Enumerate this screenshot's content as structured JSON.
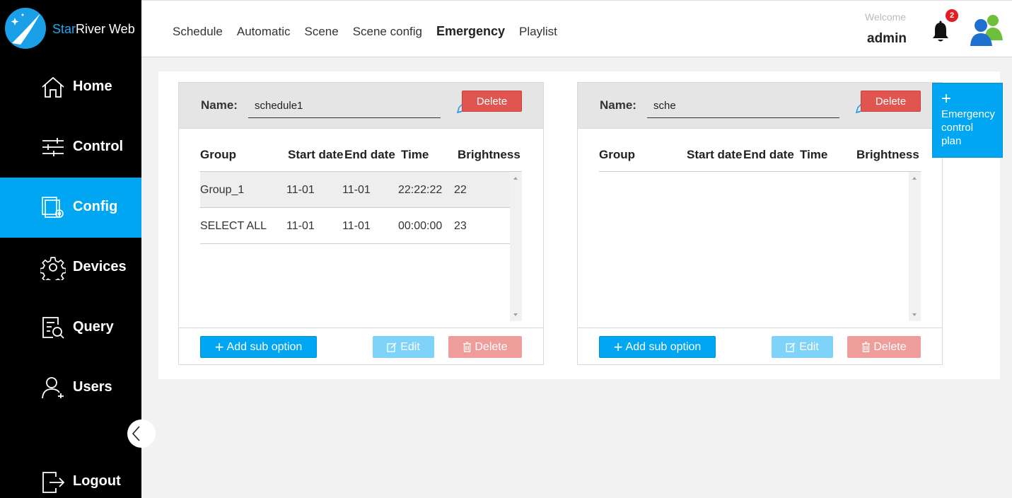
{
  "app": {
    "title_star": "Star",
    "title_rest": "River Web"
  },
  "sidebar": {
    "items": [
      {
        "label": "Home",
        "icon": "home-icon"
      },
      {
        "label": "Control",
        "icon": "sliders-icon"
      },
      {
        "label": "Config",
        "icon": "config-icon",
        "active": true
      },
      {
        "label": "Devices",
        "icon": "gear-icon"
      },
      {
        "label": "Query",
        "icon": "query-icon"
      },
      {
        "label": "Users",
        "icon": "user-icon"
      },
      {
        "label": "Logout",
        "icon": "logout-icon"
      }
    ],
    "active_color": "#00a6f2"
  },
  "header": {
    "tabs": [
      "Schedule",
      "Automatic",
      "Scene",
      "Scene config",
      "Emergency",
      "Playlist"
    ],
    "active_tab": "Emergency",
    "welcome": "Welcome",
    "username": "admin",
    "notification_count": "2"
  },
  "panels": [
    {
      "name_label": "Name:",
      "name_value": "schedule1",
      "delete_label": "Delete",
      "columns": [
        "Group",
        "Start date",
        "End date",
        "Time",
        "Brightness"
      ],
      "rows": [
        {
          "group": "Group_1",
          "start": "11-01",
          "end": "11-01",
          "time": "22:22:22",
          "brightness": "22"
        },
        {
          "group": "SELECT ALL",
          "start": "11-01",
          "end": "11-01",
          "time": "00:00:00",
          "brightness": "23"
        }
      ],
      "add_label": "Add sub option",
      "edit_label": "Edit",
      "remove_label": "Delete"
    },
    {
      "name_label": "Name:",
      "name_value": "sche",
      "delete_label": "Delete",
      "columns": [
        "Group",
        "Start date",
        "End date",
        "Time",
        "Brightness"
      ],
      "rows": [],
      "add_label": "Add sub option",
      "edit_label": "Edit",
      "remove_label": "Delete"
    }
  ],
  "emergency_button": {
    "plus": "+",
    "lines": [
      "Emergency",
      "control",
      "plan"
    ]
  },
  "colors": {
    "primary": "#00a6f2",
    "danger": "#e05550",
    "edit_disabled": "#7fd2f8",
    "delete_disabled": "#ef9d9b"
  }
}
